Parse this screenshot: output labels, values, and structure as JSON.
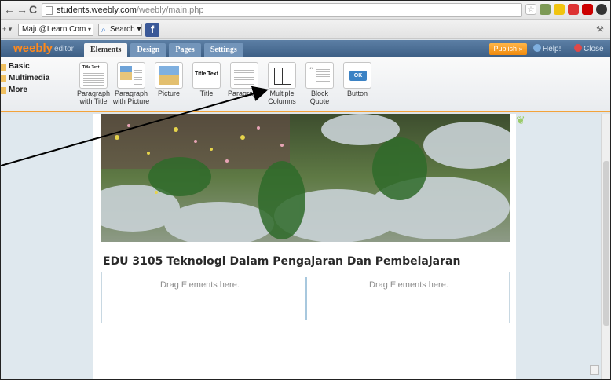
{
  "browser": {
    "back_icon": "back-arrow-icon",
    "forward_icon": "forward-arrow-icon",
    "reload_icon": "reload-icon",
    "url_host": "students.weebly.com",
    "url_path": "/weebly/main.php",
    "star_icon": "star-icon"
  },
  "toolbar": {
    "account": "Maju@Learn Com",
    "search_label": "Search",
    "facebook_icon": "facebook-icon"
  },
  "editor": {
    "logo": "weebly",
    "logo_sub": "editor",
    "tabs": [
      "Elements",
      "Design",
      "Pages",
      "Settings"
    ],
    "active_tab": "Elements",
    "publish": "Publish »",
    "help": "Help!",
    "close": "Close"
  },
  "palette": {
    "categories": [
      "Basic",
      "Multimedia",
      "More"
    ],
    "elements": [
      {
        "label1": "Paragraph",
        "label2": "with Title",
        "thumb_text": "Title Text"
      },
      {
        "label1": "Paragraph",
        "label2": "with Picture"
      },
      {
        "label1": "Picture",
        "label2": ""
      },
      {
        "label1": "Title",
        "label2": "",
        "thumb_text": "Title Text"
      },
      {
        "label1": "Paragraph",
        "label2": ""
      },
      {
        "label1": "Multiple",
        "label2": "Columns"
      },
      {
        "label1": "Block Quote",
        "label2": ""
      },
      {
        "label1": "Button",
        "label2": "",
        "thumb_text": "OK"
      }
    ]
  },
  "page": {
    "heading": "EDU 3105 Teknologi Dalam Pengajaran Dan Pembelajaran",
    "drop_left": "Drag Elements here.",
    "drop_right": "Drag Elements here."
  },
  "colors": {
    "accent_orange": "#f2a33a",
    "editor_blue": "#4a6d94",
    "annotation_arrow": "#000000"
  }
}
